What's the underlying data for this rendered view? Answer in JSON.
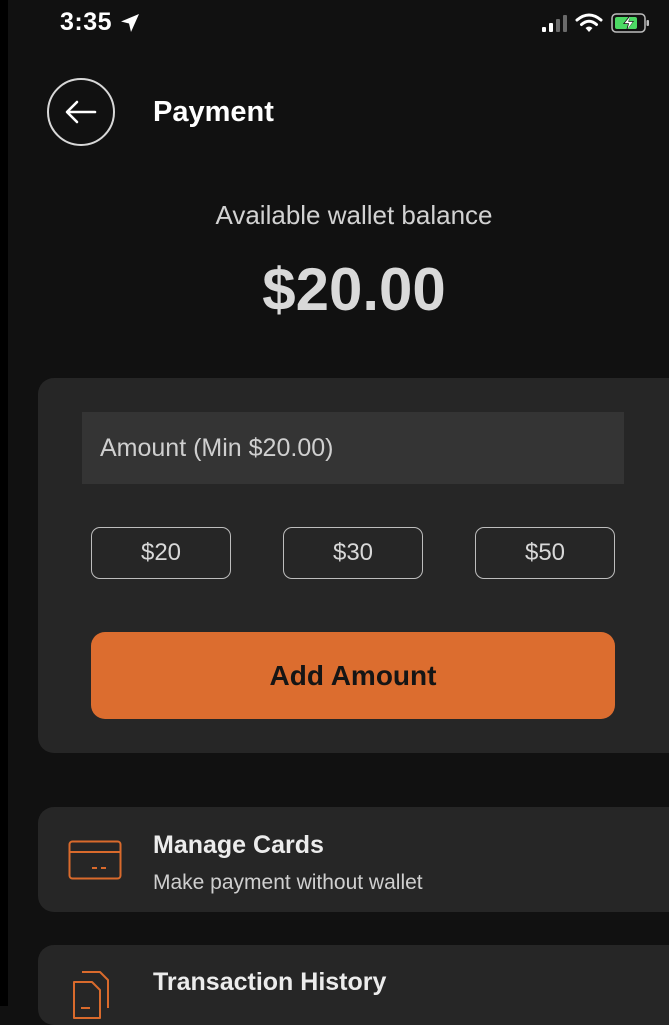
{
  "status_bar": {
    "time": "3:35"
  },
  "header": {
    "title": "Payment"
  },
  "wallet": {
    "balance_label": "Available wallet balance",
    "balance_value": "$20.00"
  },
  "add_funds": {
    "amount_placeholder": "Amount (Min $20.00)",
    "amount_value": "",
    "presets": [
      "$20",
      "$30",
      "$50"
    ],
    "submit_label": "Add Amount"
  },
  "menu": {
    "manage_cards": {
      "title": "Manage Cards",
      "subtitle": "Make payment without wallet",
      "icon": "credit-card-icon"
    },
    "transaction_history": {
      "title": "Transaction History",
      "icon": "documents-icon"
    }
  },
  "colors": {
    "background": "#111111",
    "card_background": "#262626",
    "accent": "#dc6d2f",
    "icon_accent": "#d96a2c",
    "battery_charge": "#4cd964"
  }
}
